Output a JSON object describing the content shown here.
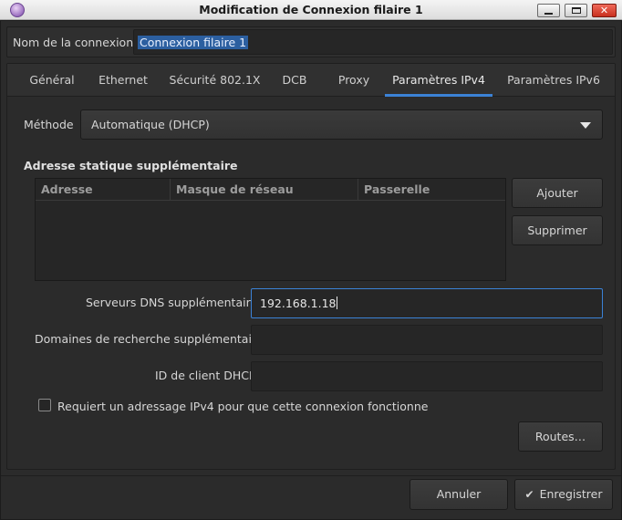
{
  "window": {
    "title": "Modification de Connexion filaire 1"
  },
  "connection": {
    "name_label": "Nom de la connexion",
    "name_value": "Connexion filaire 1"
  },
  "tabs": [
    {
      "label": "Général"
    },
    {
      "label": "Ethernet"
    },
    {
      "label": "Sécurité 802.1X"
    },
    {
      "label": "DCB"
    },
    {
      "label": "Proxy"
    },
    {
      "label": "Paramètres IPv4",
      "active": true
    },
    {
      "label": "Paramètres IPv6"
    }
  ],
  "ipv4": {
    "method_label": "Méthode",
    "method_value": "Automatique (DHCP)",
    "static_section_title": "Adresse statique supplémentaire",
    "table_headers": [
      "Adresse",
      "Masque de réseau",
      "Passerelle"
    ],
    "add_button": "Ajouter",
    "remove_button": "Supprimer",
    "dns_label": "Serveurs DNS supplémentaires",
    "dns_value": "192.168.1.18",
    "search_domains_label": "Domaines de recherche supplémentaires",
    "search_domains_value": "",
    "dhcp_client_id_label": "ID de client DHCP",
    "dhcp_client_id_value": "",
    "require_ipv4_label": "Requiert un adressage IPv4 pour que cette connexion fonctionne",
    "require_ipv4_checked": false,
    "routes_button": "Routes…"
  },
  "footer": {
    "cancel_button": "Annuler",
    "save_button": "Enregistrer"
  },
  "colors": {
    "accent": "#3b82d6",
    "background": "#2b2b2b",
    "selection": "#2c5fa0"
  }
}
